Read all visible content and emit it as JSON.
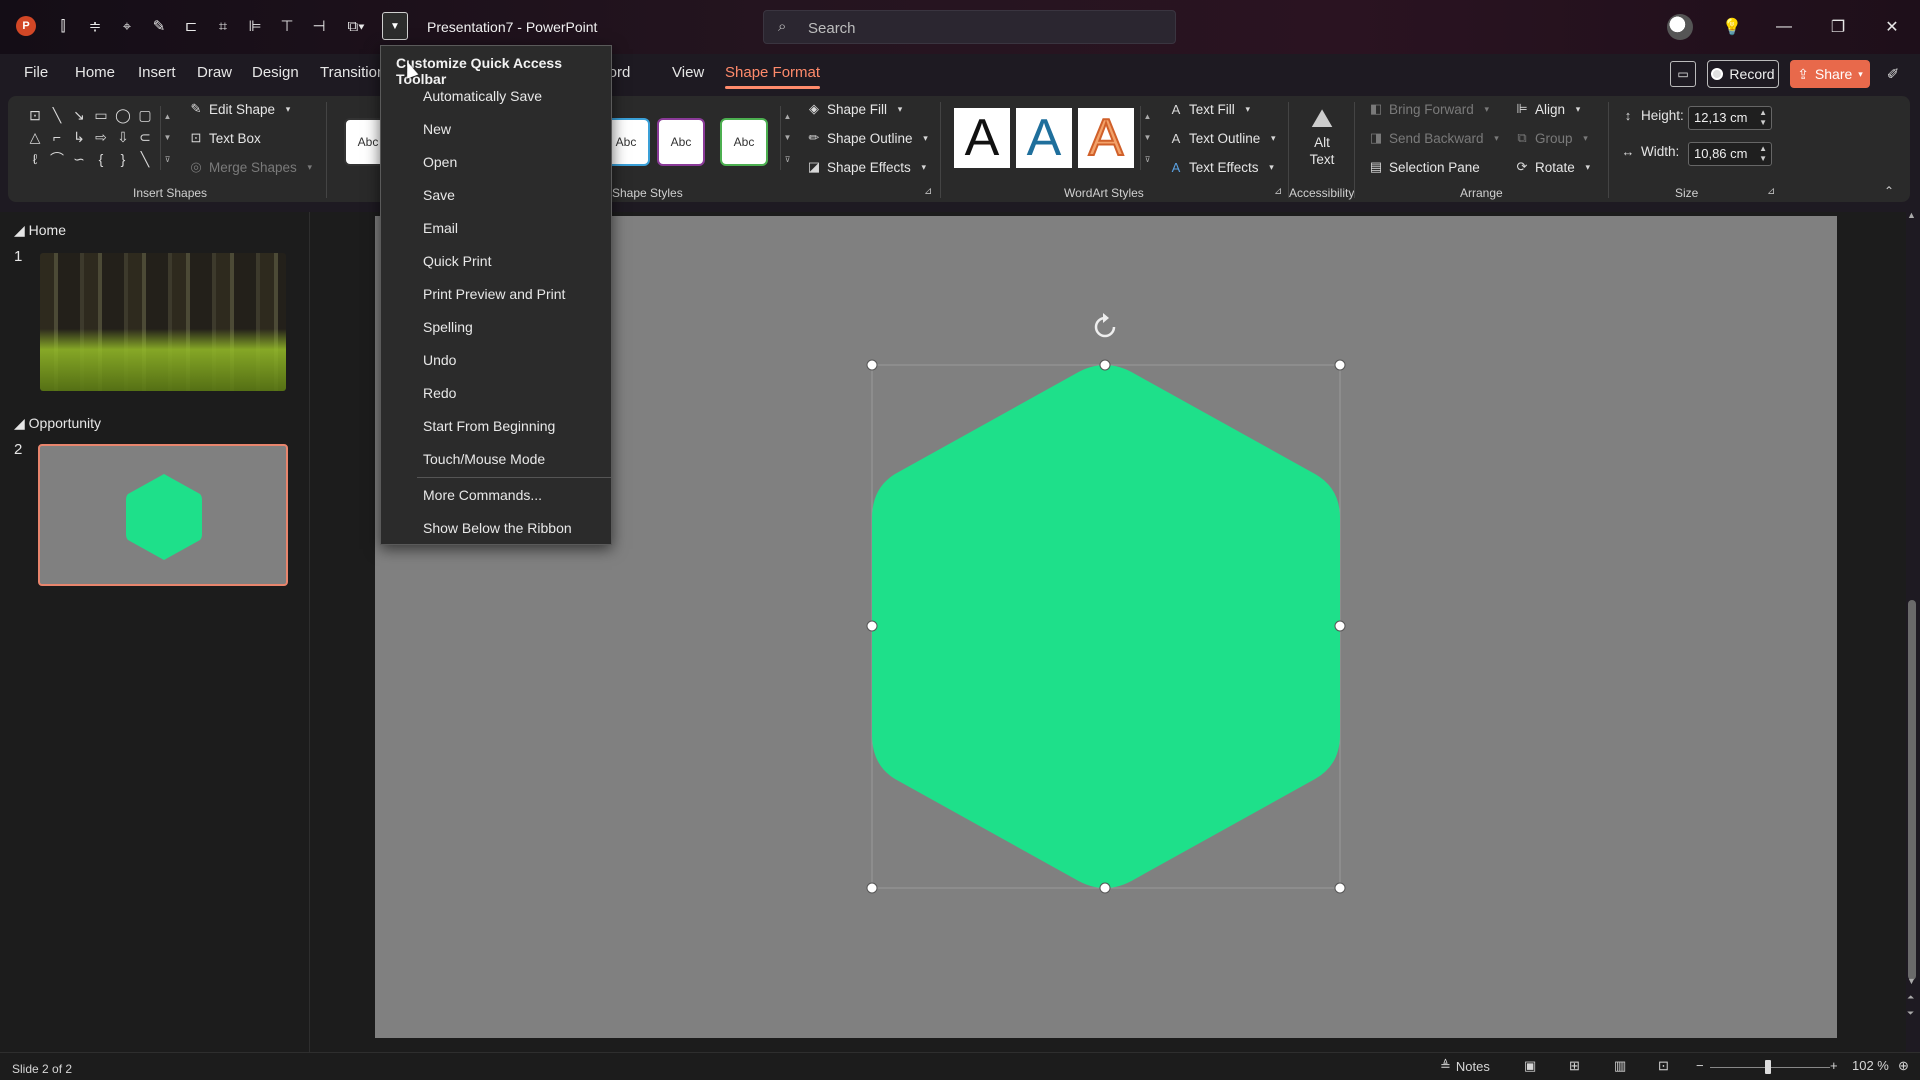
{
  "app": {
    "logo_letter": "P",
    "document_title": "Presentation7  -  PowerPoint"
  },
  "search": {
    "placeholder": "Search"
  },
  "tabs": [
    {
      "label": "File"
    },
    {
      "label": "Home"
    },
    {
      "label": "Insert"
    },
    {
      "label": "Draw"
    },
    {
      "label": "Design"
    },
    {
      "label": "Transitions"
    },
    {
      "label": "Record"
    },
    {
      "label": "View"
    },
    {
      "label": "Shape Format",
      "active": true
    }
  ],
  "header_buttons": {
    "record": "Record",
    "share": "Share"
  },
  "ribbon": {
    "insert_shapes": {
      "label": "Insert Shapes",
      "edit_shape": "Edit Shape",
      "text_box": "Text Box",
      "merge_shapes": "Merge Shapes"
    },
    "shape_styles": {
      "label": "Shape Styles",
      "swatch_text": "Abc",
      "shape_fill": "Shape Fill",
      "shape_outline": "Shape Outline",
      "shape_effects": "Shape Effects"
    },
    "wordart": {
      "label": "WordArt Styles",
      "letter": "A",
      "text_fill": "Text Fill",
      "text_outline": "Text Outline",
      "text_effects": "Text Effects"
    },
    "accessibility": {
      "label": "Accessibility",
      "alt_text_1": "Alt",
      "alt_text_2": "Text"
    },
    "arrange": {
      "label": "Arrange",
      "bring_forward": "Bring Forward",
      "send_backward": "Send Backward",
      "selection_pane": "Selection Pane",
      "align": "Align",
      "group": "Group",
      "rotate": "Rotate"
    },
    "size": {
      "label": "Size",
      "height_label": "Height:",
      "height_value": "12,13 cm",
      "width_label": "Width:",
      "width_value": "10,86 cm"
    }
  },
  "qat_menu": {
    "title": "Customize Quick Access Toolbar",
    "items": [
      "Automatically Save",
      "New",
      "Open",
      "Save",
      "Email",
      "Quick Print",
      "Print Preview and Print",
      "Spelling",
      "Undo",
      "Redo",
      "Start From Beginning",
      "Touch/Mouse Mode"
    ],
    "more_commands": "More Commands...",
    "show_below": "Show Below the Ribbon"
  },
  "slides_panel": {
    "sections": [
      {
        "name": "Home",
        "slide_number": "1"
      },
      {
        "name": "Opportunity",
        "slide_number": "2"
      }
    ]
  },
  "slide": {
    "shape_color": "#1ee08a",
    "background": "#808080"
  },
  "status": {
    "slide_info": "Slide 2 of 2",
    "notes": "Notes",
    "zoom": "102 %"
  },
  "colors": {
    "accent": "#ff8a6b",
    "share": "#e8694b"
  }
}
